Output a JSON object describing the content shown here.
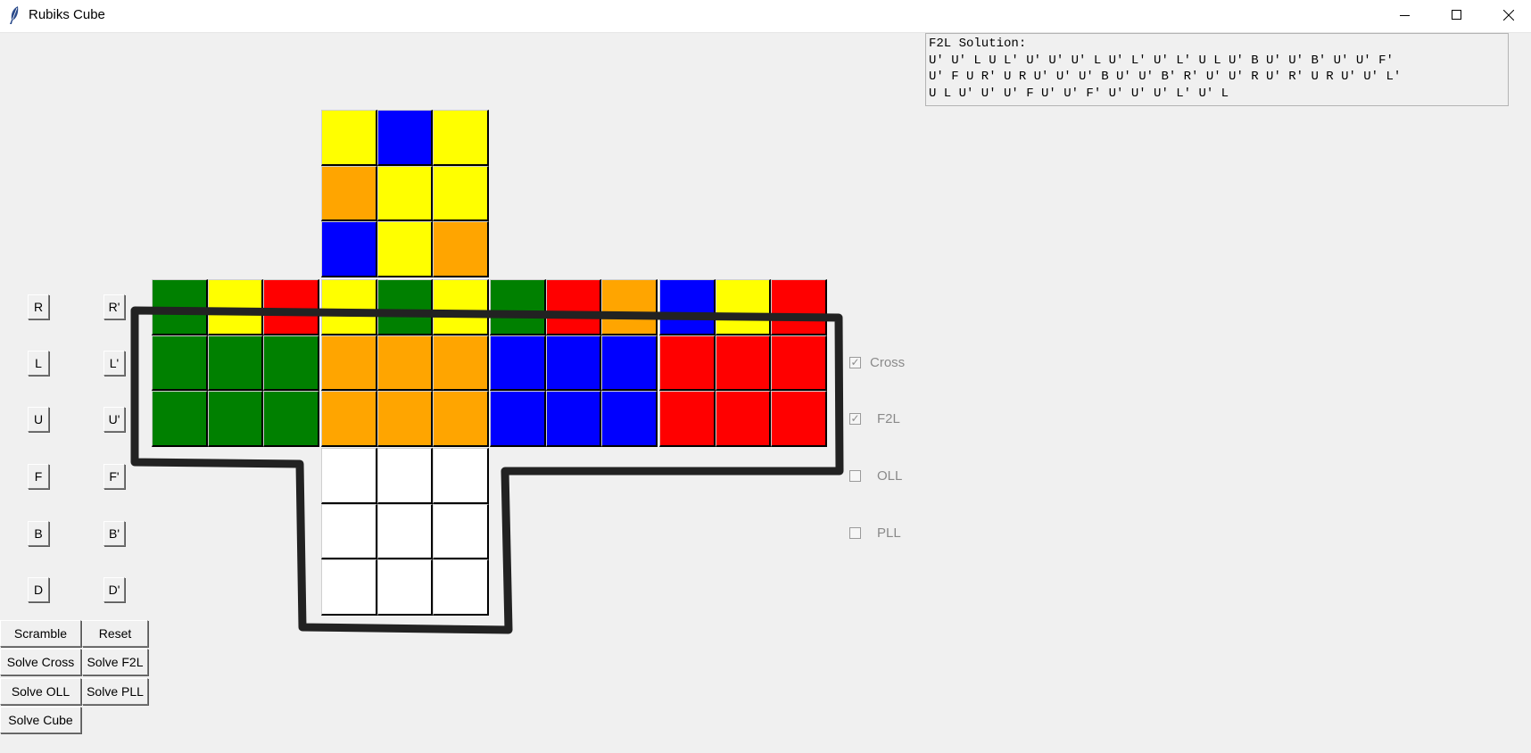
{
  "window": {
    "title": "Rubiks Cube"
  },
  "solution_box": {
    "text": "F2L Solution:\nU' U' L U L' U' U' U' L U' L' U' L' U L U' B U' U' B' U' U' F'\nU' F U R' U R U' U' U' B U' U' B' R' U' U' R U' R' U R U' U' L'\nU L U' U' U' F U' U' F' U' U' U' L' U' L"
  },
  "colors": {
    "Y": "#ffff00",
    "B": "#0000ff",
    "O": "#ffa500",
    "G": "#008000",
    "R": "#ff0000",
    "W": "#ffffff"
  },
  "cube": {
    "up": [
      [
        "Y",
        "B",
        "Y"
      ],
      [
        "O",
        "Y",
        "Y"
      ],
      [
        "B",
        "Y",
        "O"
      ]
    ],
    "left": [
      [
        "G",
        "Y",
        "R"
      ],
      [
        "G",
        "G",
        "G"
      ],
      [
        "G",
        "G",
        "G"
      ]
    ],
    "front": [
      [
        "Y",
        "G",
        "Y"
      ],
      [
        "O",
        "O",
        "O"
      ],
      [
        "O",
        "O",
        "O"
      ]
    ],
    "right": [
      [
        "G",
        "R",
        "O"
      ],
      [
        "B",
        "B",
        "B"
      ],
      [
        "B",
        "B",
        "B"
      ]
    ],
    "back": [
      [
        "B",
        "Y",
        "R"
      ],
      [
        "R",
        "R",
        "R"
      ],
      [
        "R",
        "R",
        "R"
      ]
    ],
    "down": [
      [
        "W",
        "W",
        "W"
      ],
      [
        "W",
        "W",
        "W"
      ],
      [
        "W",
        "W",
        "W"
      ]
    ]
  },
  "moves": [
    {
      "label": "R",
      "prime_label": "R'"
    },
    {
      "label": "L",
      "prime_label": "L'"
    },
    {
      "label": "U",
      "prime_label": "U'"
    },
    {
      "label": "F",
      "prime_label": "F'"
    },
    {
      "label": "B",
      "prime_label": "B'"
    },
    {
      "label": "D",
      "prime_label": "D'"
    }
  ],
  "actions": {
    "scramble": "Scramble",
    "reset": "Reset",
    "solve_cross": "Solve Cross",
    "solve_f2l": "Solve F2L",
    "solve_oll": "Solve OLL",
    "solve_pll": "Solve PLL",
    "solve_cube": "Solve Cube"
  },
  "stages": [
    {
      "label": "Cross",
      "checked": true
    },
    {
      "label": "F2L",
      "checked": true
    },
    {
      "label": "OLL",
      "checked": false
    },
    {
      "label": "PLL",
      "checked": false
    }
  ]
}
